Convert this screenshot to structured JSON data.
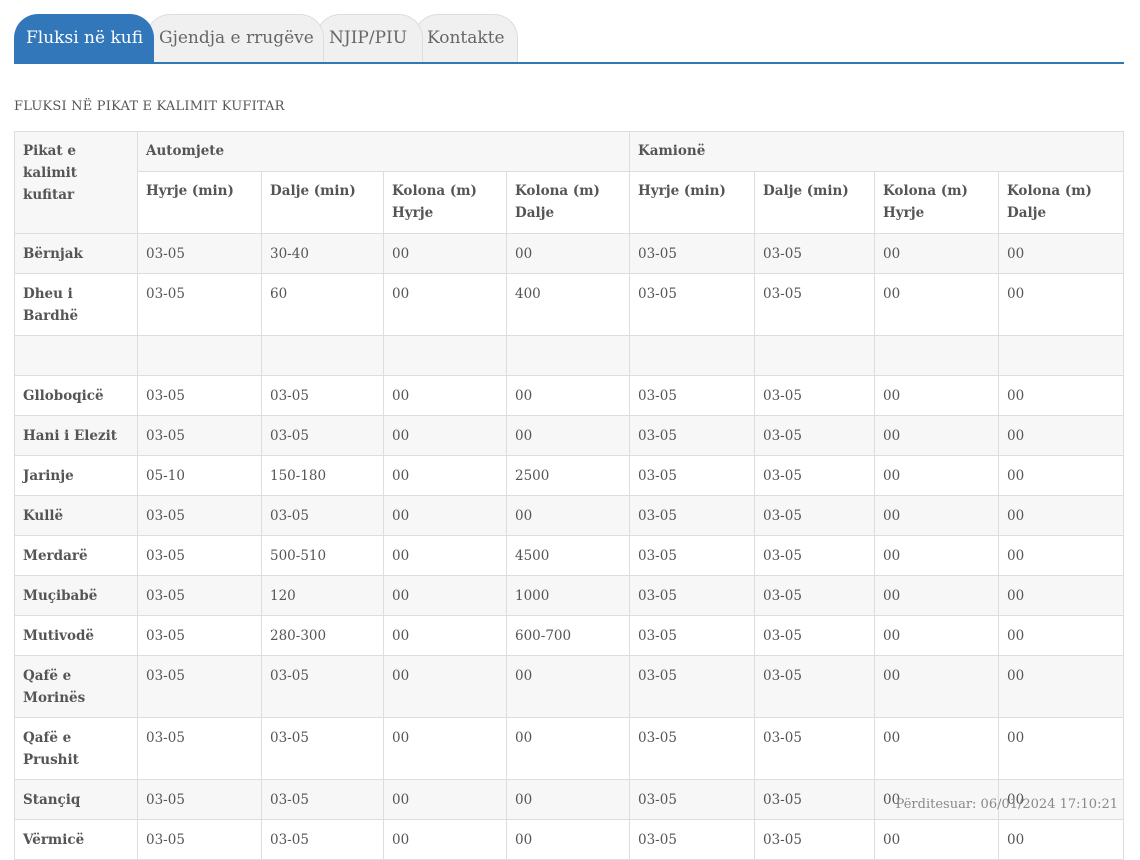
{
  "tabs": [
    {
      "label": "Fluksi në kufi",
      "active": true
    },
    {
      "label": "Gjendja e rrugëve",
      "active": false
    },
    {
      "label": "NJIP/PIU",
      "active": false
    },
    {
      "label": "Kontakte",
      "active": false
    }
  ],
  "section_title": "FLUKSI NË PIKAT E KALIMIT KUFITAR",
  "table": {
    "corner_header": "Pikat e kalimit kufitar",
    "group_headers": [
      "Automjete",
      "Kamionë"
    ],
    "sub_headers": [
      "Hyrje (min)",
      "Dalje (min)",
      "Kolona (m) Hyrje",
      "Kolona (m) Dalje",
      "Hyrje (min)",
      "Dalje (min)",
      "Kolona (m) Hyrje",
      "Kolona (m) Dalje"
    ],
    "rows": [
      {
        "name": "Bërnjak",
        "cells": [
          "03-05",
          "30-40",
          "00",
          "00",
          "03-05",
          "03-05",
          "00",
          "00"
        ]
      },
      {
        "name": "Dheu i Bardhë",
        "cells": [
          "03-05",
          "60",
          "00",
          "400",
          "03-05",
          "03-05",
          "00",
          "00"
        ]
      },
      {
        "name": "",
        "cells": [
          "",
          "",
          "",
          "",
          "",
          "",
          "",
          ""
        ]
      },
      {
        "name": "Glloboqicë",
        "cells": [
          "03-05",
          "03-05",
          "00",
          "00",
          "03-05",
          "03-05",
          "00",
          "00"
        ]
      },
      {
        "name": "Hani i Elezit",
        "cells": [
          "03-05",
          "03-05",
          "00",
          "00",
          "03-05",
          "03-05",
          "00",
          "00"
        ]
      },
      {
        "name": "Jarinje",
        "cells": [
          "05-10",
          "150-180",
          "00",
          "2500",
          "03-05",
          "03-05",
          "00",
          "00"
        ]
      },
      {
        "name": "Kullë",
        "cells": [
          "03-05",
          "03-05",
          "00",
          "00",
          "03-05",
          "03-05",
          "00",
          "00"
        ]
      },
      {
        "name": "Merdarë",
        "cells": [
          "03-05",
          "500-510",
          "00",
          "4500",
          "03-05",
          "03-05",
          "00",
          "00"
        ]
      },
      {
        "name": "Muçibabë",
        "cells": [
          "03-05",
          "120",
          "00",
          "1000",
          "03-05",
          "03-05",
          "00",
          "00"
        ]
      },
      {
        "name": "Mutivodë",
        "cells": [
          "03-05",
          "280-300",
          "00",
          "600-700",
          "03-05",
          "03-05",
          "00",
          "00"
        ]
      },
      {
        "name": "Qafë e Morinës",
        "cells": [
          "03-05",
          "03-05",
          "00",
          "00",
          "03-05",
          "03-05",
          "00",
          "00"
        ]
      },
      {
        "name": "Qafë e Prushit",
        "cells": [
          "03-05",
          "03-05",
          "00",
          "00",
          "03-05",
          "03-05",
          "00",
          "00"
        ]
      },
      {
        "name": "Stançiq",
        "cells": [
          "03-05",
          "03-05",
          "00",
          "00",
          "03-05",
          "03-05",
          "00",
          "00"
        ]
      },
      {
        "name": "Vërmicë",
        "cells": [
          "03-05",
          "03-05",
          "00",
          "00",
          "03-05",
          "03-05",
          "00",
          "00"
        ]
      }
    ]
  },
  "updated_text": "Përditesuar: 06/01/2024 17:10:21",
  "colors": {
    "accent": "#3377bb",
    "border": "#dddddd",
    "stripe": "#f7f7f7"
  }
}
